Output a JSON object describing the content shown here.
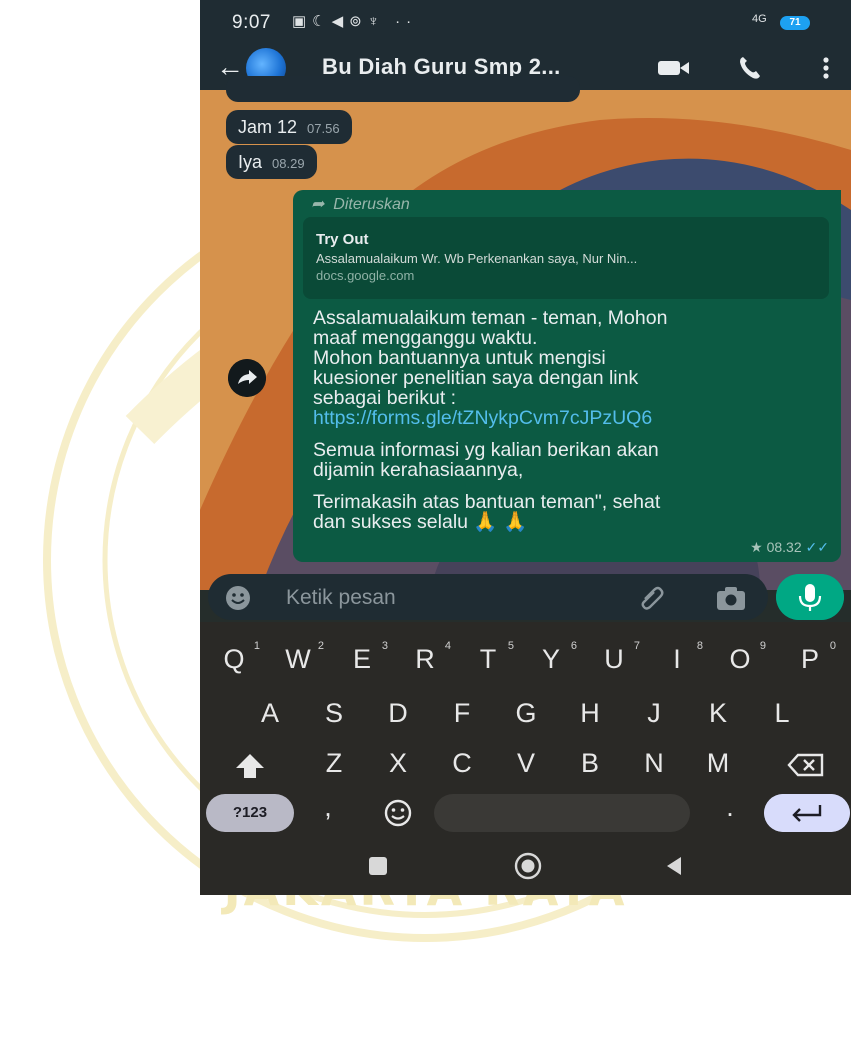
{
  "status_bar": {
    "time": "9:07",
    "network": "4G",
    "battery": "71"
  },
  "header": {
    "contact_name": "Bu Diah Guru Smp 2..."
  },
  "messages": [
    {
      "text": "Jam 12",
      "time": "07.56"
    },
    {
      "text": "Iya",
      "time": "08.29"
    }
  ],
  "outgoing": {
    "forwarded_label": "Diteruskan",
    "preview": {
      "title": "Try Out",
      "description": "Assalamualaikum Wr. Wb Perkenankan saya, Nur Nin...",
      "domain": "docs.google.com"
    },
    "line1": "Assalamualaikum teman - teman, Mohon",
    "line2": "maaf mengganggu waktu.",
    "line3": "Mohon bantuannya untuk mengisi",
    "line4": "kuesioner penelitian saya dengan link",
    "line5": "sebagai berikut :",
    "link": "https://forms.gle/tZNykpCvm7cJPzUQ6",
    "line6": "Semua informasi yg kalian berikan akan",
    "line7": "dijamin kerahasiaannya,",
    "line8": "Terimakasih atas bantuan teman\", sehat",
    "line9": "dan sukses selalu 🙏 🙏",
    "time": "08.32"
  },
  "composer": {
    "placeholder": "Ketik pesan"
  },
  "keyboard": {
    "row1": [
      {
        "key": "Q",
        "num": "1"
      },
      {
        "key": "W",
        "num": "2"
      },
      {
        "key": "E",
        "num": "3"
      },
      {
        "key": "R",
        "num": "4"
      },
      {
        "key": "T",
        "num": "5"
      },
      {
        "key": "Y",
        "num": "6"
      },
      {
        "key": "U",
        "num": "7"
      },
      {
        "key": "I",
        "num": "8"
      },
      {
        "key": "O",
        "num": "9"
      },
      {
        "key": "P",
        "num": "0"
      }
    ],
    "row2": [
      "A",
      "S",
      "D",
      "F",
      "G",
      "H",
      "J",
      "K",
      "L"
    ],
    "row3": [
      "Z",
      "X",
      "C",
      "V",
      "B",
      "N",
      "M"
    ],
    "symbols_label": "?123",
    "comma": ",",
    "period": "."
  },
  "watermark": {
    "text": "JAKARTA RAYA"
  },
  "colors": {
    "header": "#1f2c33",
    "outgoing_bubble": "#0c5a43",
    "incoming_bubble": "#1f2c34",
    "accent": "#00a884",
    "link": "#53bdeb"
  }
}
